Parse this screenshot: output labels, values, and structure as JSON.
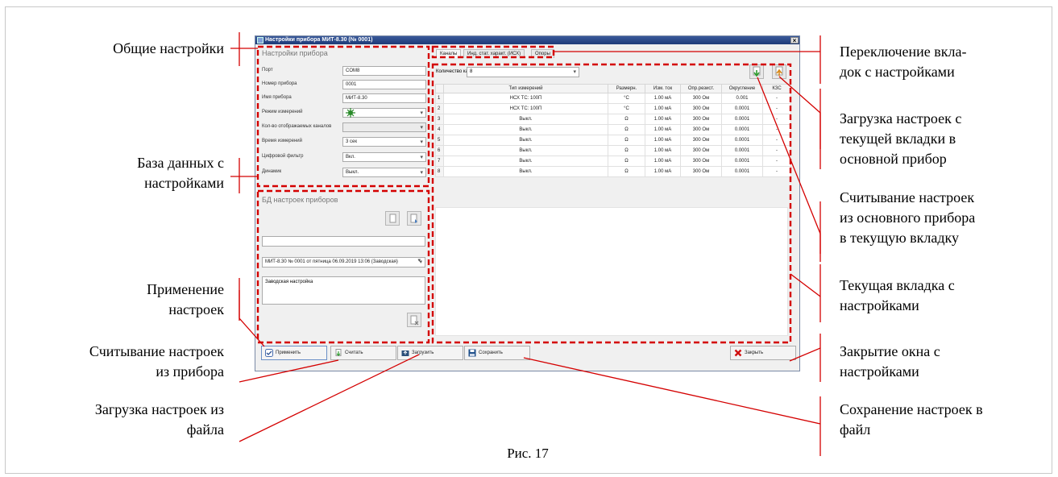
{
  "annotations": {
    "left": [
      {
        "text": "Общие настройки"
      },
      {
        "text": "База данных с\nнастройками"
      },
      {
        "text": "Применение\nнастроек"
      },
      {
        "text": "Считывание настроек\nиз прибора"
      },
      {
        "text": "Загрузка настроек из\nфайла"
      }
    ],
    "right": [
      {
        "text": "Переключение вкла-\nдок с настройками"
      },
      {
        "text": "Загрузка настроек с\nтекущей вкладки в\nосновной прибор"
      },
      {
        "text": "Считывание настроек\nиз основного прибора\nв текущую вкладку"
      },
      {
        "text": "Текущая вкладка с\nнастройками"
      },
      {
        "text": "Закрытие окна с\nнастройками"
      },
      {
        "text": "Сохранение настроек в\nфайл"
      }
    ]
  },
  "caption": "Рис. 17",
  "window": {
    "title": "Настройки прибора МИТ-8.30 (№ 0001)",
    "close_glyph": "×",
    "device_settings": {
      "legend": "Настройки прибора",
      "rows": [
        {
          "label": "Порт",
          "value": "COM8",
          "dropdown": false,
          "disabled": false
        },
        {
          "label": "Номер прибора",
          "value": "0001",
          "dropdown": false,
          "disabled": false
        },
        {
          "label": "Имя прибора",
          "value": "МИТ-8.30",
          "dropdown": false,
          "disabled": false
        },
        {
          "label": "Режим измерений",
          "value": "",
          "dropdown": true,
          "disabled": false
        },
        {
          "label": "Кол-во отображаемых каналов",
          "value": "",
          "dropdown": true,
          "disabled": true
        },
        {
          "label": "Время измерений",
          "value": "3 сек",
          "dropdown": true,
          "disabled": false
        },
        {
          "label": "Цифровой фильтр",
          "value": "Вкл.",
          "dropdown": true,
          "disabled": false
        },
        {
          "label": "Динамик",
          "value": "Выкл.",
          "dropdown": true,
          "disabled": false
        }
      ]
    },
    "database": {
      "legend": "БД настроек приборов",
      "name_input": "",
      "selected_record": "МИТ-8.30 № 0001 от пятница 06.09.2019 13:06 (Заводская)",
      "description": "Заводская настройка"
    },
    "tabs": [
      {
        "label": "Каналы",
        "active": true
      },
      {
        "label": "Инд. стат. характ. (ИСХ)",
        "active": false
      },
      {
        "label": "Опоры",
        "active": false
      }
    ],
    "channels_count": {
      "label": "Количество каналов",
      "value": "8"
    },
    "table": {
      "columns": [
        "",
        "Тип измерений",
        "Размерн.",
        "Изм. ток",
        "Опр.резист.",
        "Округление",
        "КЗС"
      ],
      "rows": [
        [
          "1",
          "НСХ ТС: 100П",
          "°С",
          "1.00 мА",
          "300 Ом",
          "0.001",
          "-"
        ],
        [
          "2",
          "НСХ ТС: 100П",
          "°С",
          "1.00 мА",
          "300 Ом",
          "0.0001",
          "-"
        ],
        [
          "3",
          "Выкл.",
          "Ω",
          "1.00 мА",
          "300 Ом",
          "0.0001",
          "-"
        ],
        [
          "4",
          "Выкл.",
          "Ω",
          "1.00 мА",
          "300 Ом",
          "0.0001",
          "-"
        ],
        [
          "5",
          "Выкл.",
          "Ω",
          "1.00 мА",
          "300 Ом",
          "0.0001",
          "-"
        ],
        [
          "6",
          "Выкл.",
          "Ω",
          "1.00 мА",
          "300 Ом",
          "0.0001",
          "-"
        ],
        [
          "7",
          "Выкл.",
          "Ω",
          "1.00 мА",
          "300 Ом",
          "0.0001",
          "-"
        ],
        [
          "8",
          "Выкл.",
          "Ω",
          "1.00 мА",
          "300 Ом",
          "0.0001",
          "-"
        ]
      ]
    },
    "buttons": {
      "apply": "Применить",
      "read": "Считать",
      "load": "Загрузить",
      "save": "Сохранить",
      "close": "Закрыть"
    }
  },
  "colors": {
    "callout": "#d40000",
    "accent_green": "#3aa33a",
    "close_red": "#d01010"
  }
}
